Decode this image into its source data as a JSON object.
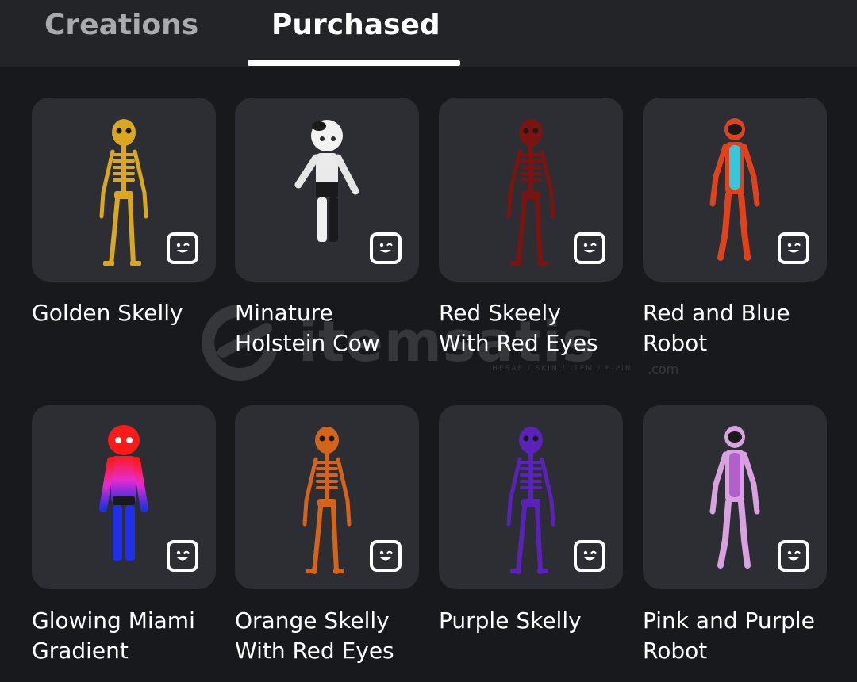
{
  "tabs": [
    {
      "label": "Creations",
      "active": false
    },
    {
      "label": "Purchased",
      "active": true
    }
  ],
  "items": [
    {
      "name": "Golden Skelly",
      "lines": [
        "Golden Skelly"
      ],
      "figure": "skeleton",
      "color": "#d9a81e",
      "icon": "emote-icon"
    },
    {
      "name": "Minature Holstein Cow",
      "lines": [
        "Minature",
        "Holstein Cow"
      ],
      "figure": "cow",
      "color": "#f2f2f2",
      "icon": "emote-icon"
    },
    {
      "name": "Red Skeely With Red Eyes",
      "lines": [
        "Red Skeely",
        "With Red Eyes"
      ],
      "figure": "skeleton",
      "color": "#7a1410",
      "icon": "emote-icon"
    },
    {
      "name": "Red and Blue Robot",
      "lines": [
        "Red and Blue",
        "Robot"
      ],
      "figure": "robot",
      "color": "#e0421c",
      "color2": "#38c6d8",
      "icon": "emote-icon"
    },
    {
      "name": "Glowing Miami Gradient",
      "lines": [
        "Glowing Miami",
        "Gradient"
      ],
      "figure": "gradient",
      "color": "#ff1a1a",
      "color2": "#e62bd0",
      "color3": "#2030e6",
      "icon": "emote-icon"
    },
    {
      "name": "Orange Skelly With Red Eyes",
      "lines": [
        "Orange Skelly",
        "With Red Eyes"
      ],
      "figure": "skeleton",
      "color": "#d4641a",
      "icon": "emote-icon"
    },
    {
      "name": "Purple Skelly",
      "lines": [
        "Purple Skelly"
      ],
      "figure": "skeleton",
      "color": "#5a22b8",
      "icon": "emote-icon"
    },
    {
      "name": "Pink and Purple Robot",
      "lines": [
        "Pink and Purple",
        "Robot"
      ],
      "figure": "robot",
      "color": "#d8a2e0",
      "color2": "#b060c8",
      "icon": "emote-icon"
    }
  ],
  "watermark": {
    "brand": "itemsatis",
    "tagline": "HESAP / SKIN / ITEM / E-PIN",
    "suffix": ".com"
  }
}
